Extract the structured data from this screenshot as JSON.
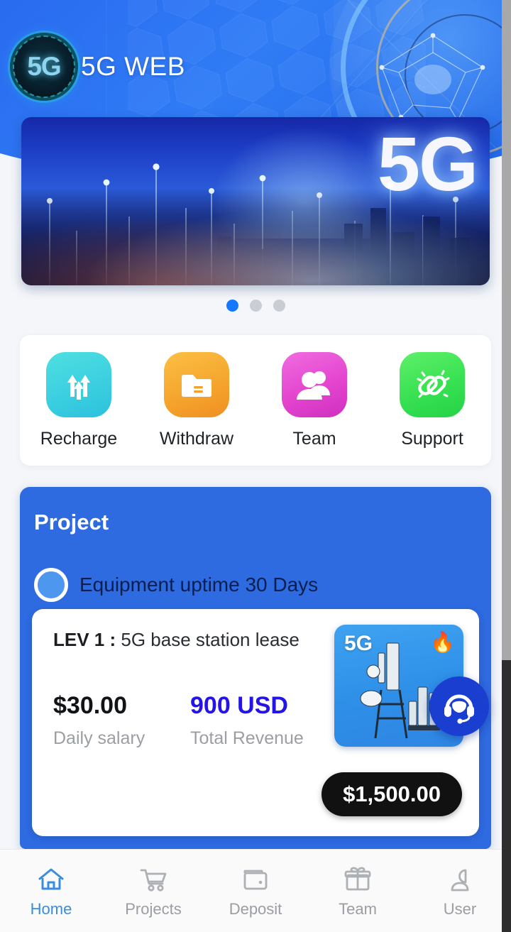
{
  "app": {
    "brand_mark": "5G",
    "brand_title": "5G WEB"
  },
  "banner": {
    "overlay_text": "5G",
    "alt": "night city skyline with 5G network light beams"
  },
  "carousel": {
    "dots": [
      {
        "name": "dot-1",
        "active": true
      },
      {
        "name": "dot-2",
        "active": false
      },
      {
        "name": "dot-3",
        "active": false
      }
    ],
    "active_index": 0,
    "active_color": "#1677ff",
    "inactive_color": "#c9cdd4"
  },
  "quick_actions": [
    {
      "label": "Recharge",
      "icon": "up-arrows-icon",
      "color": "#3ccfe0"
    },
    {
      "label": "Withdraw",
      "icon": "folder-icon",
      "color": "#f5a62e"
    },
    {
      "label": "Team",
      "icon": "people-icon",
      "color": "#e445cf"
    },
    {
      "label": "Support",
      "icon": "chain-link-icon",
      "color": "#38e152"
    }
  ],
  "project": {
    "title": "Project",
    "uptime_label": "Equipment uptime 30 Days",
    "panel_color": "#2e6ae0",
    "product": {
      "level": "LEV 1",
      "separator": ":",
      "name": "5G base station lease",
      "daily_value": "$30.00",
      "daily_label": "Daily salary",
      "total_value": "900 USD",
      "total_label": "Total Revenue",
      "total_color": "#2414e8",
      "price": "$1,500.00",
      "thumb_tag": "5G",
      "thumb_badge": "🔥",
      "thumb_alt": "5G cell tower"
    }
  },
  "support_fab": {
    "icon": "headset-support-icon",
    "color": "#1a3fd0"
  },
  "bottom_nav": {
    "active": "Home",
    "items": [
      {
        "label": "Home",
        "icon": "home-icon",
        "active": true
      },
      {
        "label": "Projects",
        "icon": "cart-icon",
        "active": false
      },
      {
        "label": "Deposit",
        "icon": "wallet-icon",
        "active": false
      },
      {
        "label": "Team",
        "icon": "gift-icon",
        "active": false
      },
      {
        "label": "User",
        "icon": "person-icon",
        "active": false
      }
    ]
  }
}
